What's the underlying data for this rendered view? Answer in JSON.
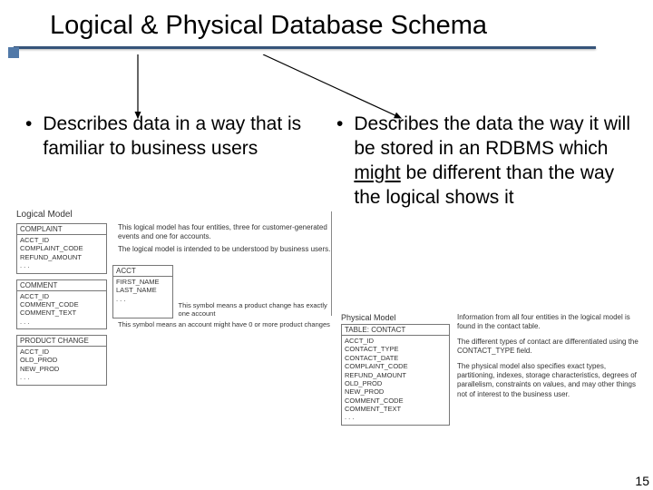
{
  "title": "Logical & Physical Database Schema",
  "left": {
    "bullet": "Describes data in a way that is familiar to business users"
  },
  "right": {
    "bullet_pre": "Describes the data the way it will be stored in an RDBMS which ",
    "bullet_u": "might",
    "bullet_post": " be different than the way the logical shows it"
  },
  "logical": {
    "label": "Logical Model",
    "desc1": "This logical model has four entities, three for customer-generated events and one for accounts.",
    "desc2": "The logical model is intended to be understood by business users.",
    "entities": {
      "complaint": {
        "name": "COMPLAINT",
        "fields": "ACCT_ID\nCOMPLAINT_CODE\nREFUND_AMOUNT\n. . ."
      },
      "comment": {
        "name": "COMMENT",
        "fields": "ACCT_ID\nCOMMENT_CODE\nCOMMENT_TEXT\n. . ."
      },
      "product_change": {
        "name": "PRODUCT CHANGE",
        "fields": "ACCT_ID\nOLD_PROD\nNEW_PROD\n. . ."
      },
      "acct": {
        "name": "ACCT",
        "fields": "FIRST_NAME\nLAST_NAME\n. . ."
      }
    },
    "sym1": "This symbol means a product change has exactly one account",
    "sym2": "This symbol means an account might have 0 or more product changes"
  },
  "physical": {
    "label": "Physical Model",
    "table": {
      "name": "TABLE: CONTACT",
      "fields": "ACCT_ID\nCONTACT_TYPE\nCONTACT_DATE\nCOMPLAINT_CODE\nREFUND_AMOUNT\nOLD_PROD\nNEW_PROD\nCOMMENT_CODE\nCOMMENT_TEXT\n. . ."
    },
    "p1": "Information from all four entities in the logical model is found in the contact table.",
    "p2": "The different types of contact are differentiated using the CONTACT_TYPE field.",
    "p3": "The physical model also specifies exact types, partitioning, indexes, storage characteristics, degrees of parallelism, constraints on values, and may other things not of interest to the business user."
  },
  "page_number": "15"
}
